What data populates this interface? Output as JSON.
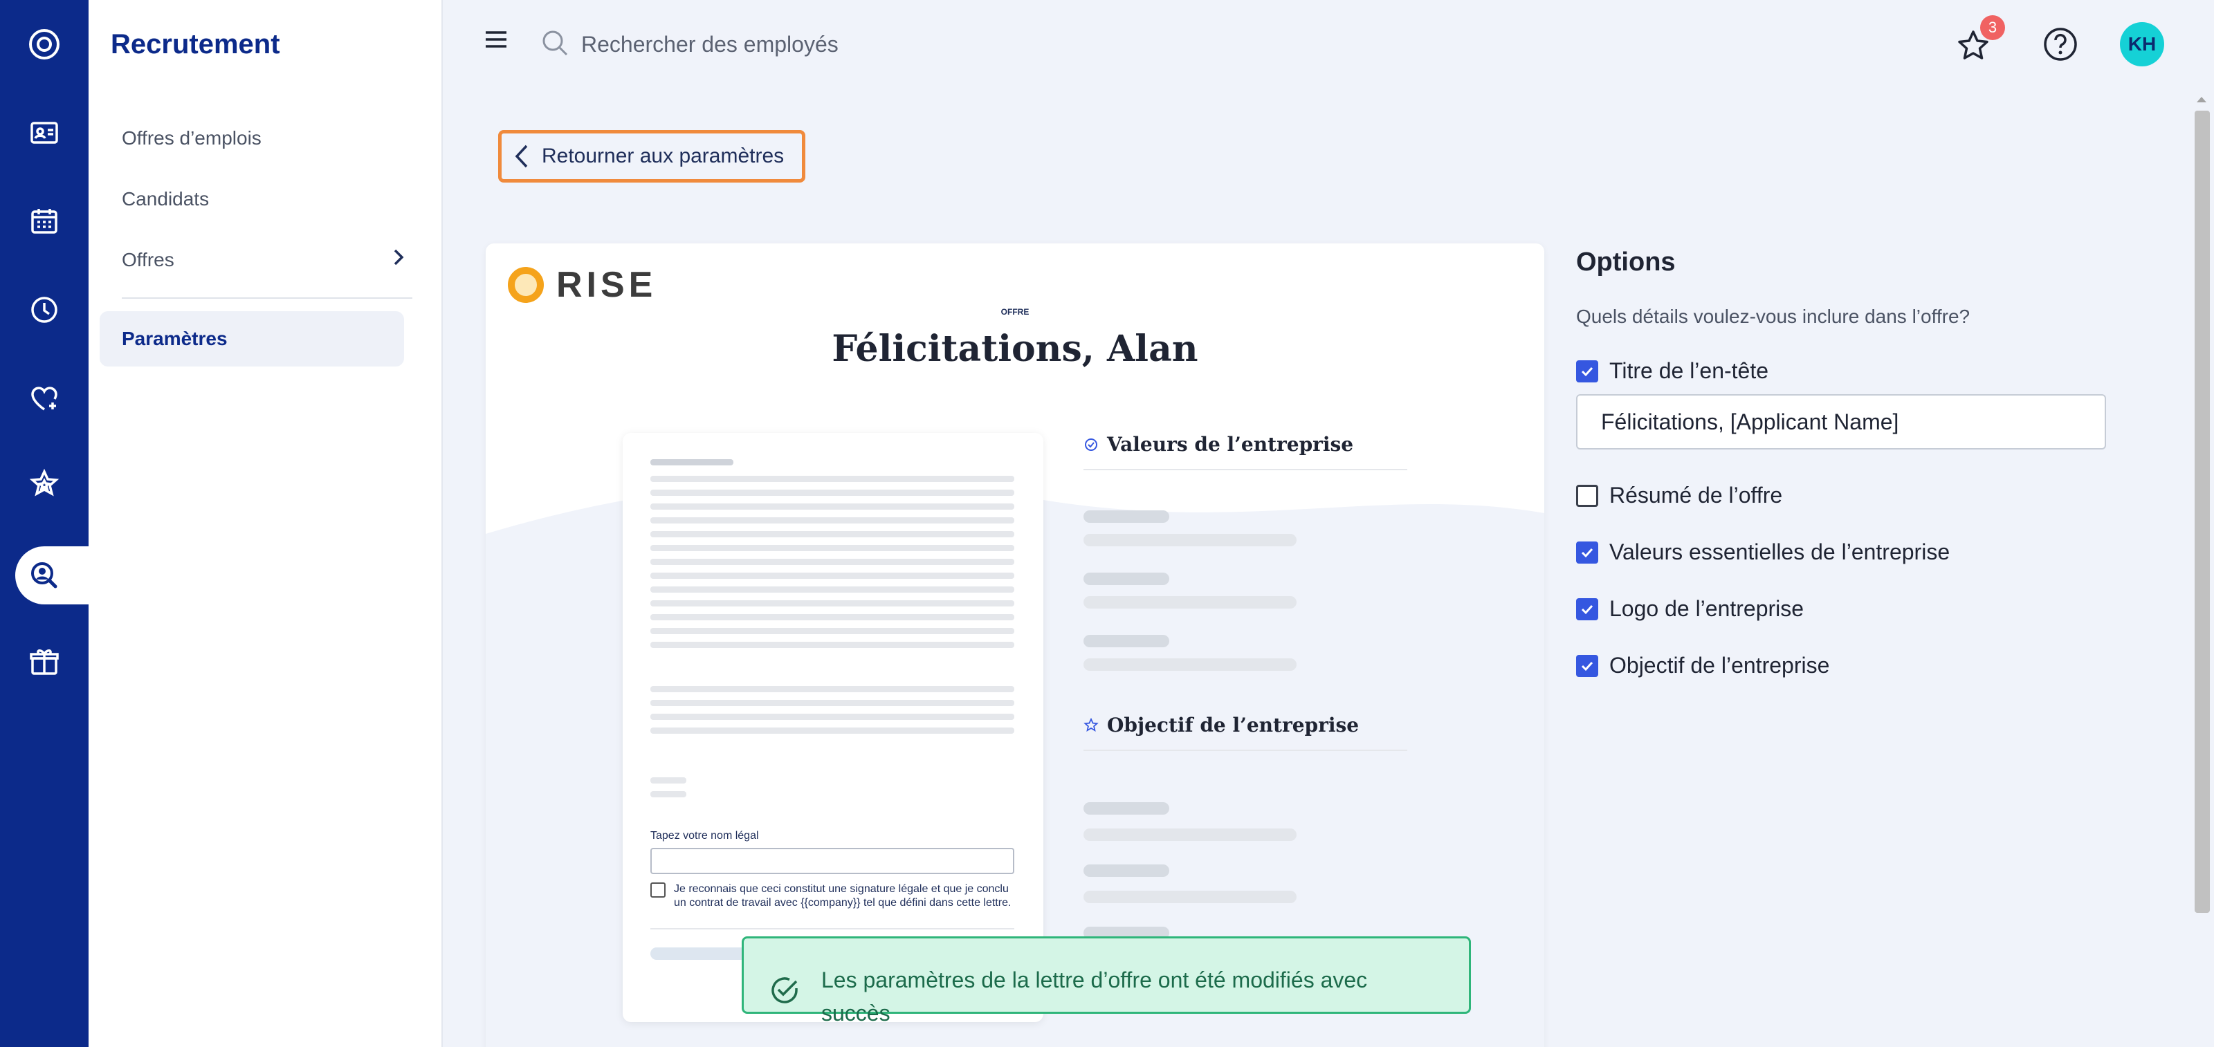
{
  "sidebar": {
    "title": "Recrutement",
    "items": [
      {
        "label": "Offres d’emplois"
      },
      {
        "label": "Candidats"
      },
      {
        "label": "Offres"
      },
      {
        "label": "Paramètres"
      }
    ]
  },
  "topbar": {
    "search_placeholder": "Rechercher des employés",
    "notification_count": "3",
    "avatar_initials": "KH"
  },
  "back_button": {
    "label": "Retourner aux paramètres"
  },
  "preview": {
    "logo_text": "RISE",
    "eyebrow": "OFFRE",
    "title": "Félicitations, Alan",
    "section_values": "Valeurs de l’entreprise",
    "section_objective": "Objectif de l’entreprise",
    "sign_label": "Tapez votre nom légal",
    "sign_ack": "Je reconnais que ceci constitut une signature légale et que je conclu un contrat de travail avec {{company}} tel que défini dans cette lettre."
  },
  "options": {
    "title": "Options",
    "subtitle": "Quels détails voulez-vous inclure dans l’offre?",
    "header_value": "Félicitations, [Applicant Name]",
    "items": [
      {
        "label": "Titre de l’en-tête",
        "checked": true
      },
      {
        "label": "Résumé de l’offre",
        "checked": false
      },
      {
        "label": "Valeurs essentielles de l’entreprise",
        "checked": true
      },
      {
        "label": "Logo de l’entreprise",
        "checked": true
      },
      {
        "label": "Objectif de l’entreprise",
        "checked": true
      }
    ]
  },
  "toast": {
    "message": "Les paramètres de la lettre d’offre ont été modifiés avec succès"
  },
  "colors": {
    "rail": "#0c2a8a",
    "accent": "#3557e0",
    "focus_outline": "#f08a3c",
    "toast_bg": "#d4f5e6",
    "avatar": "#15d1d6",
    "badge": "#f06262"
  }
}
